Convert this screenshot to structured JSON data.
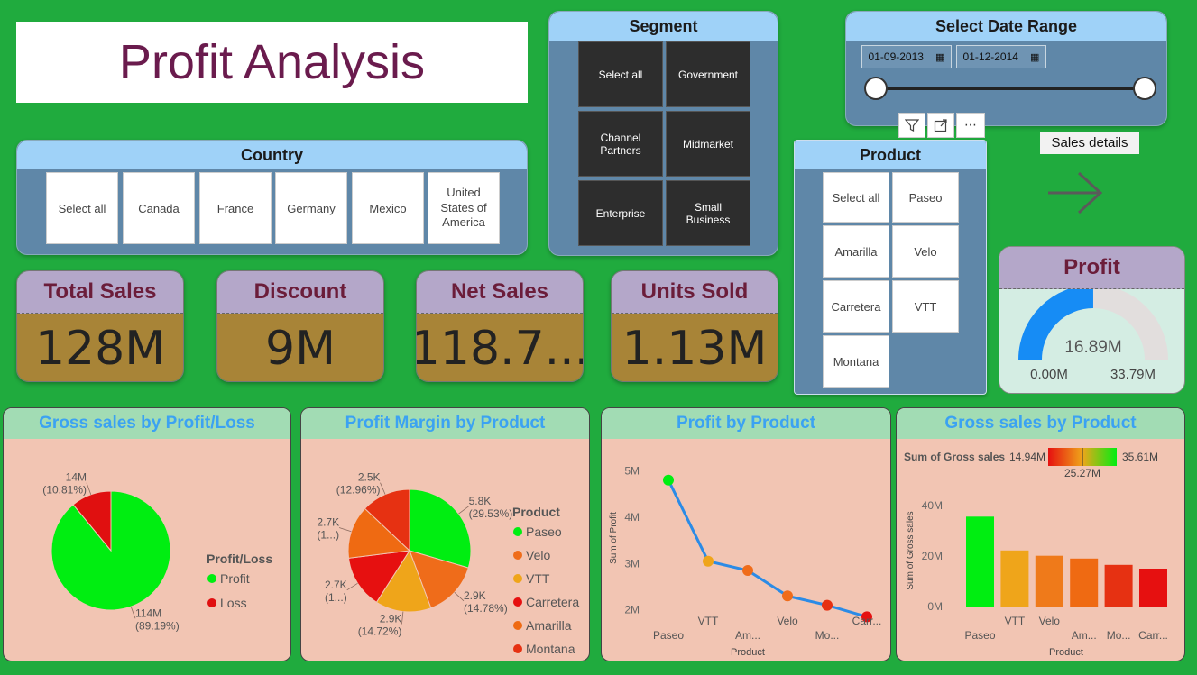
{
  "title": "Profit Analysis",
  "country": {
    "title": "Country",
    "items": [
      "Select all",
      "Canada",
      "France",
      "Germany",
      "Mexico",
      "United States of America"
    ]
  },
  "segment": {
    "title": "Segment",
    "items": [
      "Select all",
      "Government",
      "Channel Partners",
      "Midmarket",
      "Enterprise",
      "Small Business"
    ]
  },
  "date_range": {
    "title": "Select Date Range",
    "start": "01-09-2013",
    "end": "01-12-2014"
  },
  "product_slicer": {
    "title": "Product",
    "items": [
      "Select all",
      "Paseo",
      "Amarilla",
      "Velo",
      "Carretera",
      "VTT",
      "Montana"
    ]
  },
  "sales_details": {
    "label": "Sales details"
  },
  "kpis": [
    {
      "label": "Total Sales",
      "value": "128M"
    },
    {
      "label": "Discount",
      "value": "9M"
    },
    {
      "label": "Net Sales",
      "value": "118.7..."
    },
    {
      "label": "Units Sold",
      "value": "1.13M"
    }
  ],
  "profit_gauge": {
    "title": "Profit",
    "value": "16.89M",
    "min": "0.00M",
    "max": "33.79M",
    "value_num": 16.89,
    "max_num": 33.79
  },
  "colors": {
    "bg": "#20ab3e",
    "accent_title": "#3ba2f2"
  },
  "charts": {
    "gross_profit_loss": {
      "title": "Gross sales by Profit/Loss"
    },
    "profit_margin": {
      "title": "Profit Margin by Product"
    },
    "profit_by_product": {
      "title": "Profit by Product"
    },
    "gross_by_product": {
      "title": "Gross sales by Product"
    }
  },
  "chart_data": [
    {
      "type": "pie",
      "title": "Gross sales by Profit/Loss",
      "legend_title": "Profit/Loss",
      "slices": [
        {
          "name": "Profit",
          "value": 114,
          "label": "114M",
          "pct": "(89.19%)",
          "color": "#00ee11"
        },
        {
          "name": "Loss",
          "value": 14,
          "label": "14M",
          "pct": "(10.81%)",
          "color": "#e01010"
        }
      ]
    },
    {
      "type": "pie",
      "title": "Profit Margin by Product",
      "legend_title": "Product",
      "slices": [
        {
          "name": "Paseo",
          "value": 29.53,
          "label": "5.8K",
          "pct": "(29.53%)",
          "color": "#00ee11"
        },
        {
          "name": "Velo",
          "value": 14.78,
          "label": "2.9K",
          "pct": "(14.78%)",
          "color": "#ef6c1a"
        },
        {
          "name": "VTT",
          "value": 14.72,
          "label": "2.9K",
          "pct": "(14.72%)",
          "color": "#efa51a"
        },
        {
          "name": "Carretera",
          "value": 14.0,
          "label": "2.7K",
          "pct": "(1...)",
          "color": "#e61010"
        },
        {
          "name": "Amarilla",
          "value": 14.0,
          "label": "2.7K",
          "pct": "(1...)",
          "color": "#ef6a12"
        },
        {
          "name": "Montana",
          "value": 12.96,
          "label": "2.5K",
          "pct": "(12.96%)",
          "color": "#e63112"
        }
      ]
    },
    {
      "type": "line",
      "title": "Profit by Product",
      "xlabel": "Product",
      "ylabel": "Sum of Profit",
      "yticks": [
        "2M",
        "3M",
        "4M",
        "5M"
      ],
      "ylim": [
        1.8,
        5.3
      ],
      "categories": [
        "Paseo",
        "VTT",
        "Am...",
        "Velo",
        "Mo...",
        "Carr..."
      ],
      "values": [
        4.8,
        3.05,
        2.85,
        2.3,
        2.1,
        1.85
      ],
      "point_colors": [
        "#00ee11",
        "#efa51a",
        "#ef6c1a",
        "#ef6c1a",
        "#e63112",
        "#e61010"
      ]
    },
    {
      "type": "bar",
      "title": "Gross sales by Product",
      "xlabel": "Product",
      "ylabel": "Sum of Gross sales",
      "legend_title": "Sum of Gross sales",
      "scale": {
        "min": "14.94M",
        "mid": "25.27M",
        "max": "35.61M"
      },
      "yticks": [
        "0M",
        "20M",
        "40M"
      ],
      "ylim": [
        0,
        45
      ],
      "categories": [
        "Paseo",
        "VTT",
        "Velo",
        "Am...",
        "Mo...",
        "Carr..."
      ],
      "values": [
        35.6,
        22.2,
        20.1,
        19.0,
        16.5,
        15.0
      ],
      "bar_colors": [
        "#00ee11",
        "#efa51a",
        "#ef7a1a",
        "#ef6a12",
        "#e63112",
        "#e61010"
      ]
    }
  ]
}
